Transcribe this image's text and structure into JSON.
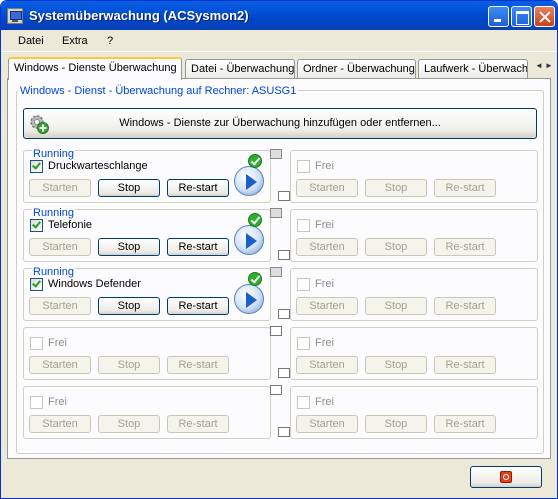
{
  "window": {
    "title": "Systemüberwachung (ACSysmon2)"
  },
  "menu": [
    {
      "label": "Datei"
    },
    {
      "label": "Extra"
    },
    {
      "label": "?"
    }
  ],
  "tabs": [
    {
      "label": "Windows - Dienste Überwachung",
      "active": true
    },
    {
      "label": "Datei - Überwachung"
    },
    {
      "label": "Ordner - Überwachung"
    },
    {
      "label": "Laufwerk - Überwach"
    }
  ],
  "tab_scroll": {
    "left": "◄",
    "right": "►"
  },
  "panel": {
    "group_title": "Windows - Dienst - Überwachung auf Rechner: ASUSG1",
    "add_button_label": "Windows - Dienste zur Überwachung hinzufügen oder entfernen..."
  },
  "button_labels": {
    "start": "Starten",
    "stop": "Stop",
    "restart": "Re-start"
  },
  "slots": [
    {
      "status": "Running",
      "name": "Druckwarteschlange",
      "checked": true,
      "active": true
    },
    {
      "status": "",
      "name": "Frei",
      "checked": false,
      "active": false
    },
    {
      "status": "Running",
      "name": "Telefonie",
      "checked": true,
      "active": true
    },
    {
      "status": "",
      "name": "Frei",
      "checked": false,
      "active": false
    },
    {
      "status": "Running",
      "name": "Windows Defender",
      "checked": true,
      "active": true
    },
    {
      "status": "",
      "name": "Frei",
      "checked": false,
      "active": false
    },
    {
      "status": "",
      "name": "Frei",
      "checked": false,
      "active": false
    },
    {
      "status": "",
      "name": "Frei",
      "checked": false,
      "active": false
    },
    {
      "status": "",
      "name": "Frei",
      "checked": false,
      "active": false
    },
    {
      "status": "",
      "name": "Frei",
      "checked": false,
      "active": false
    }
  ],
  "colors": {
    "status_blue": "#0046d5",
    "ok_green": "#2fae2f",
    "titlebar": "#0356dd"
  },
  "icons": {
    "add": "gear-plus-icon",
    "play": "play-icon",
    "ok": "check-icon",
    "close": "close-icon"
  }
}
